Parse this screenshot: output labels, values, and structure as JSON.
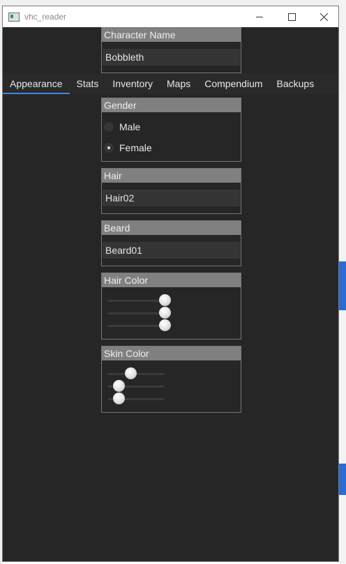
{
  "window": {
    "title": "vhc_reader"
  },
  "character_name": {
    "label": "Character Name",
    "value": "Bobbleth"
  },
  "tabs": [
    {
      "label": "Appearance",
      "active": true
    },
    {
      "label": "Stats",
      "active": false
    },
    {
      "label": "Inventory",
      "active": false
    },
    {
      "label": "Maps",
      "active": false
    },
    {
      "label": "Compendium",
      "active": false
    },
    {
      "label": "Backups",
      "active": false
    }
  ],
  "gender": {
    "label": "Gender",
    "options": [
      {
        "label": "Male",
        "checked": false
      },
      {
        "label": "Female",
        "checked": true
      }
    ]
  },
  "hair": {
    "label": "Hair",
    "value": "Hair02"
  },
  "beard": {
    "label": "Beard",
    "value": "Beard01"
  },
  "hair_color": {
    "label": "Hair Color",
    "slider_levels": [
      1.0,
      1.0,
      1.0
    ]
  },
  "skin_color": {
    "label": "Skin Color",
    "slider_levels": [
      0.4,
      0.2,
      0.2
    ]
  }
}
